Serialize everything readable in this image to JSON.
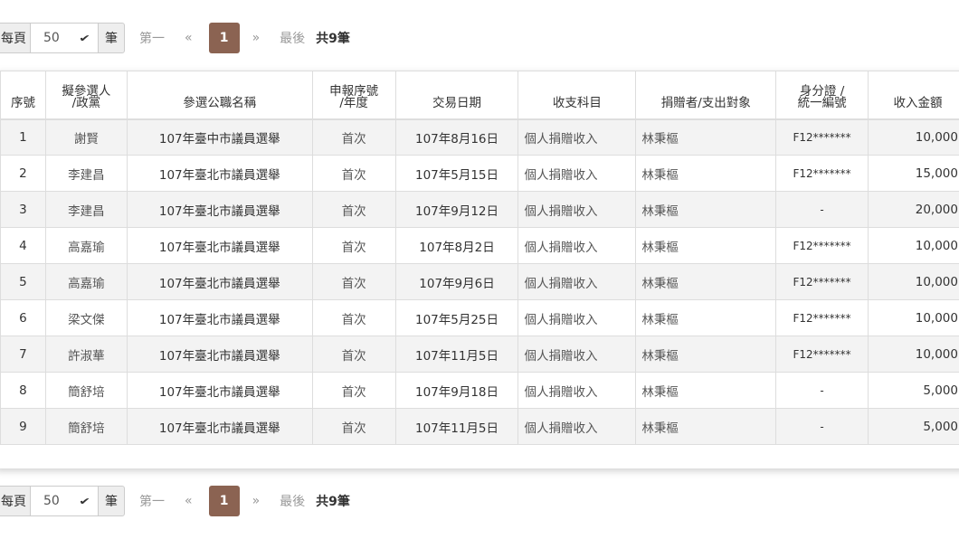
{
  "pager": {
    "per_page_prefix": "每頁",
    "per_page_value": "50",
    "per_page_suffix": "筆",
    "first": "第一",
    "prev": "«",
    "current_page": "1",
    "next": "»",
    "last": "最後",
    "total": "共9筆"
  },
  "table": {
    "headers": {
      "no": "序號",
      "candidate_a": "擬參選人",
      "candidate_b": "/政黨",
      "office": "參選公職名稱",
      "report_a": "申報序號",
      "report_b": "/年度",
      "date": "交易日期",
      "category": "收支科目",
      "donor": "捐贈者/支出對象",
      "id_a": "身分證 /",
      "id_b": "統一編號",
      "amount": "收入金額"
    },
    "rows": [
      {
        "no": "1",
        "candidate": "謝賢",
        "office": "107年臺中市議員選舉",
        "report": "首次",
        "date": "107年8月16日",
        "category": "個人捐贈收入",
        "donor": "林秉樞",
        "id": "F12*******",
        "amount": "10,000"
      },
      {
        "no": "2",
        "candidate": "李建昌",
        "office": "107年臺北市議員選舉",
        "report": "首次",
        "date": "107年5月15日",
        "category": "個人捐贈收入",
        "donor": "林秉樞",
        "id": "F12*******",
        "amount": "15,000"
      },
      {
        "no": "3",
        "candidate": "李建昌",
        "office": "107年臺北市議員選舉",
        "report": "首次",
        "date": "107年9月12日",
        "category": "個人捐贈收入",
        "donor": "林秉樞",
        "id": "-",
        "amount": "20,000"
      },
      {
        "no": "4",
        "candidate": "高嘉瑜",
        "office": "107年臺北市議員選舉",
        "report": "首次",
        "date": "107年8月2日",
        "category": "個人捐贈收入",
        "donor": "林秉樞",
        "id": "F12*******",
        "amount": "10,000"
      },
      {
        "no": "5",
        "candidate": "高嘉瑜",
        "office": "107年臺北市議員選舉",
        "report": "首次",
        "date": "107年9月6日",
        "category": "個人捐贈收入",
        "donor": "林秉樞",
        "id": "F12*******",
        "amount": "10,000"
      },
      {
        "no": "6",
        "candidate": "梁文傑",
        "office": "107年臺北市議員選舉",
        "report": "首次",
        "date": "107年5月25日",
        "category": "個人捐贈收入",
        "donor": "林秉樞",
        "id": "F12*******",
        "amount": "10,000"
      },
      {
        "no": "7",
        "candidate": "許淑華",
        "office": "107年臺北市議員選舉",
        "report": "首次",
        "date": "107年11月5日",
        "category": "個人捐贈收入",
        "donor": "林秉樞",
        "id": "F12*******",
        "amount": "10,000"
      },
      {
        "no": "8",
        "candidate": "簡舒培",
        "office": "107年臺北市議員選舉",
        "report": "首次",
        "date": "107年9月18日",
        "category": "個人捐贈收入",
        "donor": "林秉樞",
        "id": "-",
        "amount": "5,000"
      },
      {
        "no": "9",
        "candidate": "簡舒培",
        "office": "107年臺北市議員選舉",
        "report": "首次",
        "date": "107年11月5日",
        "category": "個人捐贈收入",
        "donor": "林秉樞",
        "id": "-",
        "amount": "5,000"
      }
    ]
  },
  "colors": {
    "active_page": "#8b6352",
    "stripe": "#f3f3f3",
    "border": "#dddddd"
  }
}
